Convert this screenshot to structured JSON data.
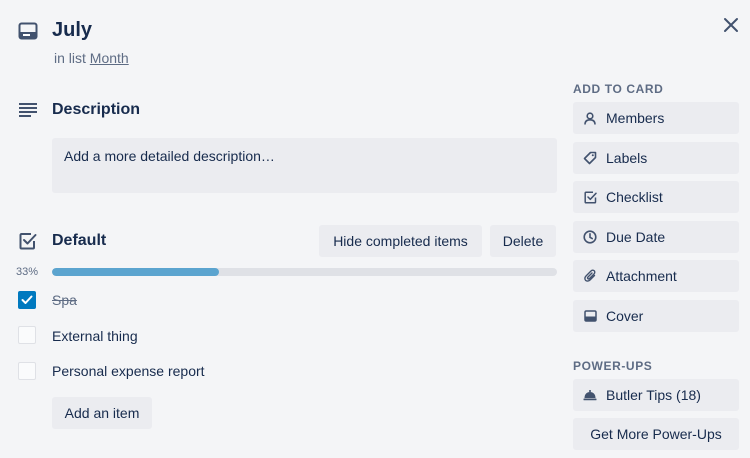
{
  "card": {
    "title": "July",
    "in_list_prefix": "in list",
    "list_name": "Month"
  },
  "description": {
    "heading": "Description",
    "placeholder": "Add a more detailed description…"
  },
  "checklist": {
    "heading": "Default",
    "hide_completed_label": "Hide completed items",
    "delete_label": "Delete",
    "progress_text": "33%",
    "progress_value": 0.33,
    "items": [
      {
        "text": "Spa",
        "checked": true
      },
      {
        "text": "External thing",
        "checked": false
      },
      {
        "text": "Personal expense report",
        "checked": false
      }
    ],
    "add_item_label": "Add an item"
  },
  "sidebar": {
    "add_to_card_label": "ADD TO CARD",
    "actions": [
      {
        "label": "Members",
        "icon": "person-icon"
      },
      {
        "label": "Labels",
        "icon": "tag-icon"
      },
      {
        "label": "Checklist",
        "icon": "checkbox-icon"
      },
      {
        "label": "Due Date",
        "icon": "clock-icon"
      },
      {
        "label": "Attachment",
        "icon": "paperclip-icon"
      },
      {
        "label": "Cover",
        "icon": "card-icon"
      }
    ],
    "powerups_label": "POWER-UPS",
    "butler_label": "Butler Tips (18)",
    "butler_icon": "butler-bell-icon",
    "more_powerups_label": "Get More Power-Ups"
  },
  "colors": {
    "accent": "#0079bf",
    "progress": "#5ba4cf",
    "background": "#f4f5f7",
    "button": "#ebecf0"
  }
}
